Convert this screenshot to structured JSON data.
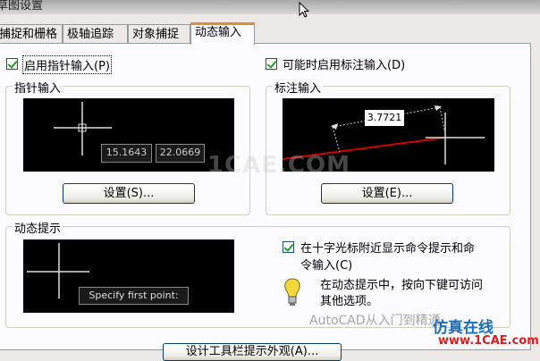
{
  "window": {
    "title": "草图设置"
  },
  "tabs": [
    {
      "label": "捕捉和栅格"
    },
    {
      "label": "极轴追踪"
    },
    {
      "label": "对象捕捉"
    },
    {
      "label": "动态输入",
      "active": true
    }
  ],
  "pointer": {
    "enable_checkbox_label": "启用指针输入(P)",
    "enable_checked": true,
    "group_label": "指针输入",
    "preview": {
      "x_value": "15.1643",
      "y_value": "22.0669"
    },
    "settings_button": "设置(S)..."
  },
  "dimension": {
    "enable_checkbox_label": "可能时启用标注输入(D)",
    "enable_checked": true,
    "group_label": "标注输入",
    "preview": {
      "dim_value": "3.7721"
    },
    "settings_button": "设置(E)..."
  },
  "prompts": {
    "group_label": "动态提示",
    "preview": {
      "prompt_text": "Specify first point:"
    },
    "show_checkbox_label_line1": "在十字光标附近显示命令提示和命",
    "show_checkbox_label_line2": "令输入(C)",
    "show_checked": true,
    "info_text_line1": "在动态提示中，按向下键可访问",
    "info_text_line2": "其他选项。"
  },
  "bottom_button": "设计工具栏提示外观(A)...",
  "watermarks": {
    "center": "1CAE.COM",
    "wechat": "AutoCAD从入门到精通",
    "brand": "仿真在线",
    "site": "www.1CAE.com"
  },
  "colors": {
    "accent_tab": "#e68b2c",
    "check": "#21a121",
    "dim_line": "#d40000"
  }
}
